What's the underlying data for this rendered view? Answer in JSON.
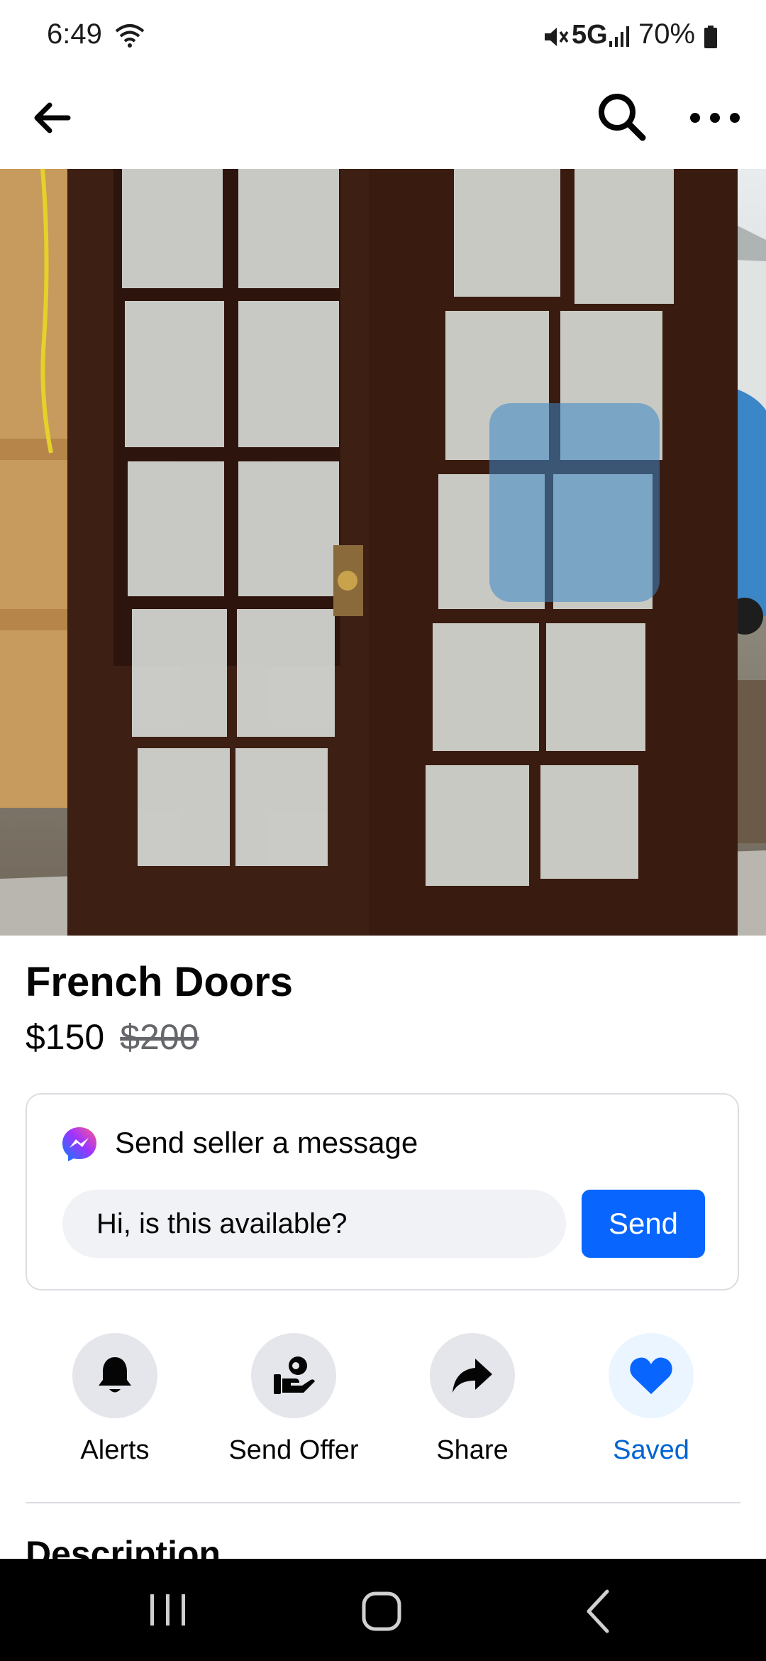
{
  "status": {
    "time": "6:49",
    "network": "5G",
    "battery": "70%"
  },
  "listing": {
    "title": "French Doors",
    "price": "$150",
    "original_price": "$200"
  },
  "message_card": {
    "heading": "Send seller a message",
    "input_value": "Hi, is this available?",
    "send_label": "Send"
  },
  "actions": [
    {
      "label": "Alerts",
      "icon": "bell-icon"
    },
    {
      "label": "Send Offer",
      "icon": "offer-icon"
    },
    {
      "label": "Share",
      "icon": "share-icon"
    },
    {
      "label": "Saved",
      "icon": "heart-icon"
    }
  ],
  "description": {
    "heading": "Description"
  },
  "colors": {
    "accent": "#0866ff",
    "saved_text": "#0064d1",
    "saved_bg": "#ebf5ff",
    "icon_circle_bg": "#e4e6eb"
  }
}
